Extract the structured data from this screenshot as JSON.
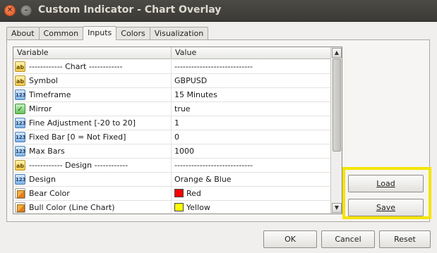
{
  "window": {
    "title": "Custom Indicator - Chart Overlay"
  },
  "tabs": [
    {
      "label": "About"
    },
    {
      "label": "Common"
    },
    {
      "label": "Inputs",
      "active": true
    },
    {
      "label": "Colors"
    },
    {
      "label": "Visualization"
    }
  ],
  "grid": {
    "headers": {
      "variable": "Variable",
      "value": "Value"
    },
    "rows": [
      {
        "icon": "text-icon",
        "name": "------------    Chart    ------------",
        "value": "----------------------------"
      },
      {
        "icon": "text-icon",
        "name": "Symbol",
        "value": "GBPUSD"
      },
      {
        "icon": "number-icon",
        "name": "Timeframe",
        "value": "15 Minutes"
      },
      {
        "icon": "checkbox-icon",
        "name": "Mirror",
        "value": "true"
      },
      {
        "icon": "number-icon",
        "name": "Fine Adjustment [-20 to 20]",
        "value": "1"
      },
      {
        "icon": "number-icon",
        "name": "Fixed Bar [0 = Not Fixed]",
        "value": "0"
      },
      {
        "icon": "number-icon",
        "name": "Max Bars",
        "value": "1000"
      },
      {
        "icon": "text-icon",
        "name": "------------    Design    ------------",
        "value": "----------------------------"
      },
      {
        "icon": "number-icon",
        "name": "Design",
        "value": "Orange & Blue"
      },
      {
        "icon": "color-icon",
        "name": "Bear Color",
        "value": "Red",
        "swatch": "#ff0000"
      },
      {
        "icon": "color-icon",
        "name": "Bull Color (Line Chart)",
        "value": "Yellow",
        "swatch": "#ffff00"
      }
    ]
  },
  "side_buttons": {
    "load": "Load",
    "save": "Save"
  },
  "footer_buttons": {
    "ok": "OK",
    "cancel": "Cancel",
    "reset": "Reset"
  },
  "colors": {
    "highlight": "#f5e400"
  }
}
